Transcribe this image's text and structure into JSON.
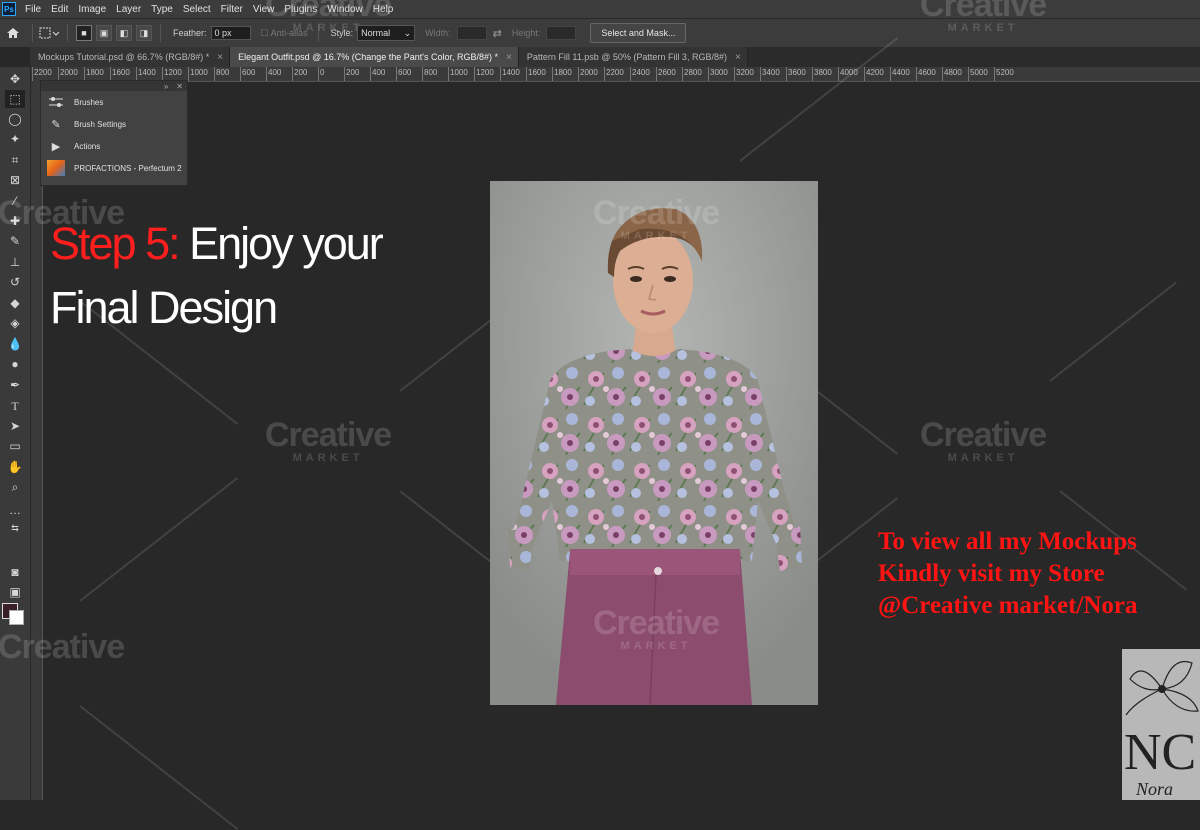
{
  "menu": {
    "app_logo": "Ps",
    "items": [
      "File",
      "Edit",
      "Image",
      "Layer",
      "Type",
      "Select",
      "Filter",
      "View",
      "Plugins",
      "Window",
      "Help"
    ]
  },
  "options_bar": {
    "feather_label": "Feather:",
    "feather_value": "0 px",
    "antialias_label": "Anti-alias",
    "style_label": "Style:",
    "style_value": "Normal",
    "width_label": "Width:",
    "height_label": "Height:",
    "select_mask_label": "Select and Mask..."
  },
  "tabs": [
    {
      "label": "Mockups Tutorial.psd @ 66.7% (RGB/8#) *",
      "active": false
    },
    {
      "label": "Elegant Outfit.psd @ 16.7% (Change the Pant's Color, RGB/8#) *",
      "active": true
    },
    {
      "label": "Pattern Fill 11.psb @ 50% (Pattern Fill 3, RGB/8#)",
      "active": false
    }
  ],
  "ruler_labels": [
    "2200",
    "2000",
    "1800",
    "1600",
    "1400",
    "1200",
    "1000",
    "800",
    "600",
    "400",
    "200",
    "0",
    "200",
    "400",
    "600",
    "800",
    "1000",
    "1200",
    "1400",
    "1600",
    "1800",
    "2000",
    "2200",
    "2400",
    "2600",
    "2800",
    "3000",
    "3200",
    "3400",
    "3600",
    "3800",
    "4000",
    "4200",
    "4400",
    "4600",
    "4800",
    "5000",
    "5200"
  ],
  "panel": {
    "items": [
      {
        "label": "Brushes",
        "icon": "brushes-icon"
      },
      {
        "label": "Brush Settings",
        "icon": "brush-settings-icon"
      },
      {
        "label": "Actions",
        "icon": "play-icon"
      },
      {
        "label": "PROFACTIONS - Perfectum 2",
        "icon": "thumbnail"
      }
    ]
  },
  "overlay": {
    "step_prefix": "Step 5:",
    "step_text_1": "Enjoy  your",
    "step_text_2": "Final Design",
    "store_line_1": "To view all my Mockups",
    "store_line_2": "Kindly visit my Store",
    "store_line_3": "@Creative market/Nora"
  },
  "watermark": {
    "brand": "Creative",
    "sub": "MARKET"
  },
  "logo": {
    "initials": "NC",
    "script": "Nora"
  },
  "colors": {
    "foreground": "#3a1f29",
    "background": "#ffffff",
    "accent_red": "#ff1313",
    "canvas": "#282828"
  }
}
